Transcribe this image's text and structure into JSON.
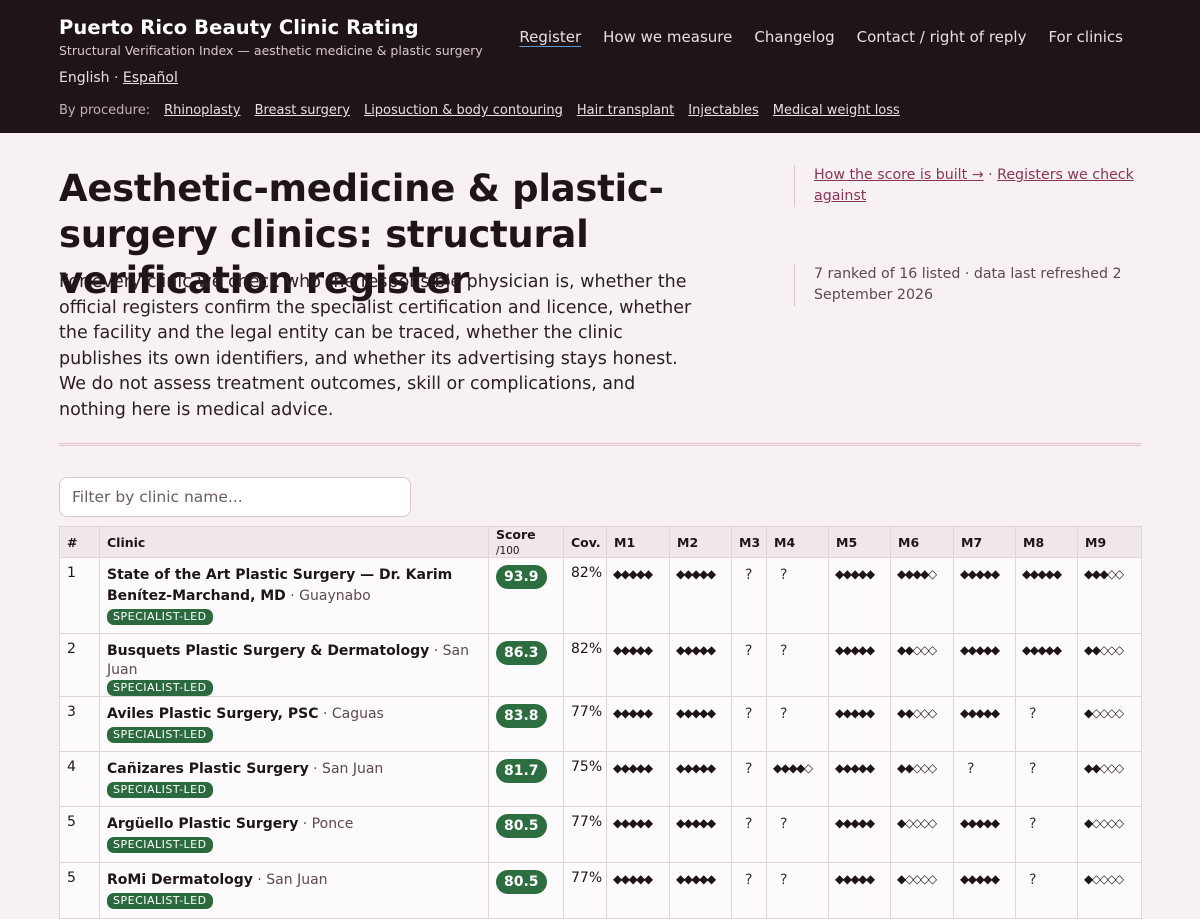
{
  "header": {
    "title": "Puerto Rico Beauty Clinic Rating",
    "subtitle": "Structural Verification Index — aesthetic medicine & plastic surgery",
    "nav": [
      "Register",
      "How we measure",
      "Changelog",
      "Contact / right of reply",
      "For clinics"
    ],
    "lang_current": "English",
    "lang_sep": " · ",
    "lang_other": "Español",
    "procedure_label": "By procedure:",
    "procedures": [
      "Rhinoplasty",
      "Breast surgery",
      "Liposuction & body contouring",
      "Hair transplant",
      "Injectables",
      "Medical weight loss"
    ]
  },
  "hero": {
    "title": "Aesthetic-medicine & plastic-surgery clinics: structural verification register",
    "intro": "For every clinic we check who the responsible physician is, whether the official registers confirm the specialist certification and licence, whether the facility and the legal entity can be traced, whether the clinic publishes its own identifiers, and whether its advertising stays honest. We do not assess treatment outcomes, skill or complications, and nothing here is medical advice.",
    "link_score": "How the score is built →",
    "link_sep": " · ",
    "link_registers": "Registers we check against",
    "meta": "7 ranked of 16 listed · data last refreshed 2 September 2026"
  },
  "filter": {
    "placeholder": "Filter by clinic name..."
  },
  "table": {
    "headers": {
      "rank": "#",
      "clinic": "Clinic",
      "score": "Score",
      "score_unit": "/100",
      "cov": "Cov.",
      "m": [
        "M1",
        "M2",
        "M3",
        "M4",
        "M5",
        "M6",
        "M7",
        "M8",
        "M9"
      ]
    },
    "rows": [
      {
        "rank": "1",
        "name": "State of the Art Plastic Surgery — Dr. Karim Benítez-Marchand, MD",
        "city": " · Guaynabo",
        "badge": "SPECIALIST-LED",
        "score": "93.9",
        "cov": "82%",
        "m": [
          "◆◆◆◆◆",
          "◆◆◆◆◆",
          "?",
          "?",
          "◆◆◆◆◆",
          "◆◆◆◆◇",
          "◆◆◆◆◆",
          "◆◆◆◆◆",
          "◆◆◆◇◇"
        ]
      },
      {
        "rank": "2",
        "name": "Busquets Plastic Surgery & Dermatology",
        "city": " · San Juan",
        "badge": "SPECIALIST-LED",
        "score": "86.3",
        "cov": "82%",
        "m": [
          "◆◆◆◆◆",
          "◆◆◆◆◆",
          "?",
          "?",
          "◆◆◆◆◆",
          "◆◆◇◇◇",
          "◆◆◆◆◆",
          "◆◆◆◆◆",
          "◆◆◇◇◇"
        ]
      },
      {
        "rank": "3",
        "name": "Aviles Plastic Surgery, PSC",
        "city": " · Caguas",
        "badge": "SPECIALIST-LED",
        "score": "83.8",
        "cov": "77%",
        "m": [
          "◆◆◆◆◆",
          "◆◆◆◆◆",
          "?",
          "?",
          "◆◆◆◆◆",
          "◆◆◇◇◇",
          "◆◆◆◆◆",
          "?",
          "◆◇◇◇◇"
        ]
      },
      {
        "rank": "4",
        "name": "Cañizares Plastic Surgery",
        "city": " · San Juan",
        "badge": "SPECIALIST-LED",
        "score": "81.7",
        "cov": "75%",
        "m": [
          "◆◆◆◆◆",
          "◆◆◆◆◆",
          "?",
          "◆◆◆◆◇",
          "◆◆◆◆◆",
          "◆◆◇◇◇",
          "?",
          "?",
          "◆◆◇◇◇"
        ]
      },
      {
        "rank": "5",
        "name": "Argüello Plastic Surgery",
        "city": " · Ponce",
        "badge": "SPECIALIST-LED",
        "score": "80.5",
        "cov": "77%",
        "m": [
          "◆◆◆◆◆",
          "◆◆◆◆◆",
          "?",
          "?",
          "◆◆◆◆◆",
          "◆◇◇◇◇",
          "◆◆◆◆◆",
          "?",
          "◆◇◇◇◇"
        ]
      },
      {
        "rank": "5",
        "name": "RoMi Dermatology",
        "city": " · San Juan",
        "badge": "SPECIALIST-LED",
        "score": "80.5",
        "cov": "77%",
        "m": [
          "◆◆◆◆◆",
          "◆◆◆◆◆",
          "?",
          "?",
          "◆◆◆◆◆",
          "◆◇◇◇◇",
          "◆◆◆◆◆",
          "?",
          "◆◇◇◇◇"
        ]
      }
    ]
  },
  "colors": {
    "header_bg": "#1f1418",
    "page_bg": "#f7f1f3",
    "score_pill": "#2c6e3f",
    "badge": "#2a6a3e",
    "link_accent": "#8a3552"
  }
}
